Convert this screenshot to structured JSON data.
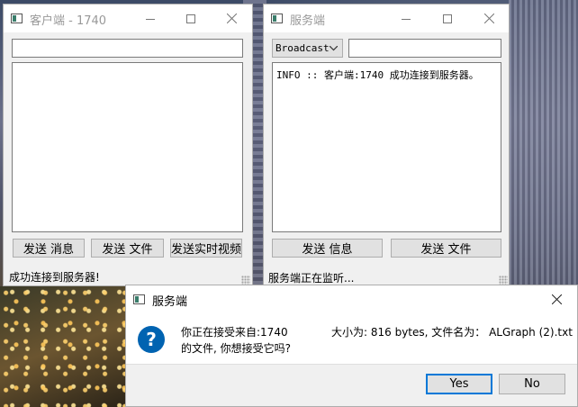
{
  "client_window": {
    "title": "客户端 - 1740",
    "message_input": "",
    "log_text": "",
    "buttons": [
      "发送 消息",
      "发送 文件",
      "发送实时视频"
    ],
    "status": "成功连接到服务器!"
  },
  "server_window": {
    "title": "服务端",
    "target_select": "Broadcast",
    "message_input": "",
    "log_text": "INFO :: 客户端:1740 成功连接到服务器。",
    "buttons": [
      "发送 信息",
      "发送 文件"
    ],
    "status": "服务端正在监听..."
  },
  "dialog": {
    "title": "服务端",
    "icon": "question-icon",
    "message_line1_left": "你正在接受来自:1740",
    "message_line1_right": "大小为: 816 bytes, 文件名为： ALGraph (2).txt",
    "message_line2": "的文件, 你想接受它吗?",
    "yes_label": "Yes",
    "no_label": "No"
  },
  "colors": {
    "accent": "#0078d7",
    "question_icon": "#0063b1"
  }
}
